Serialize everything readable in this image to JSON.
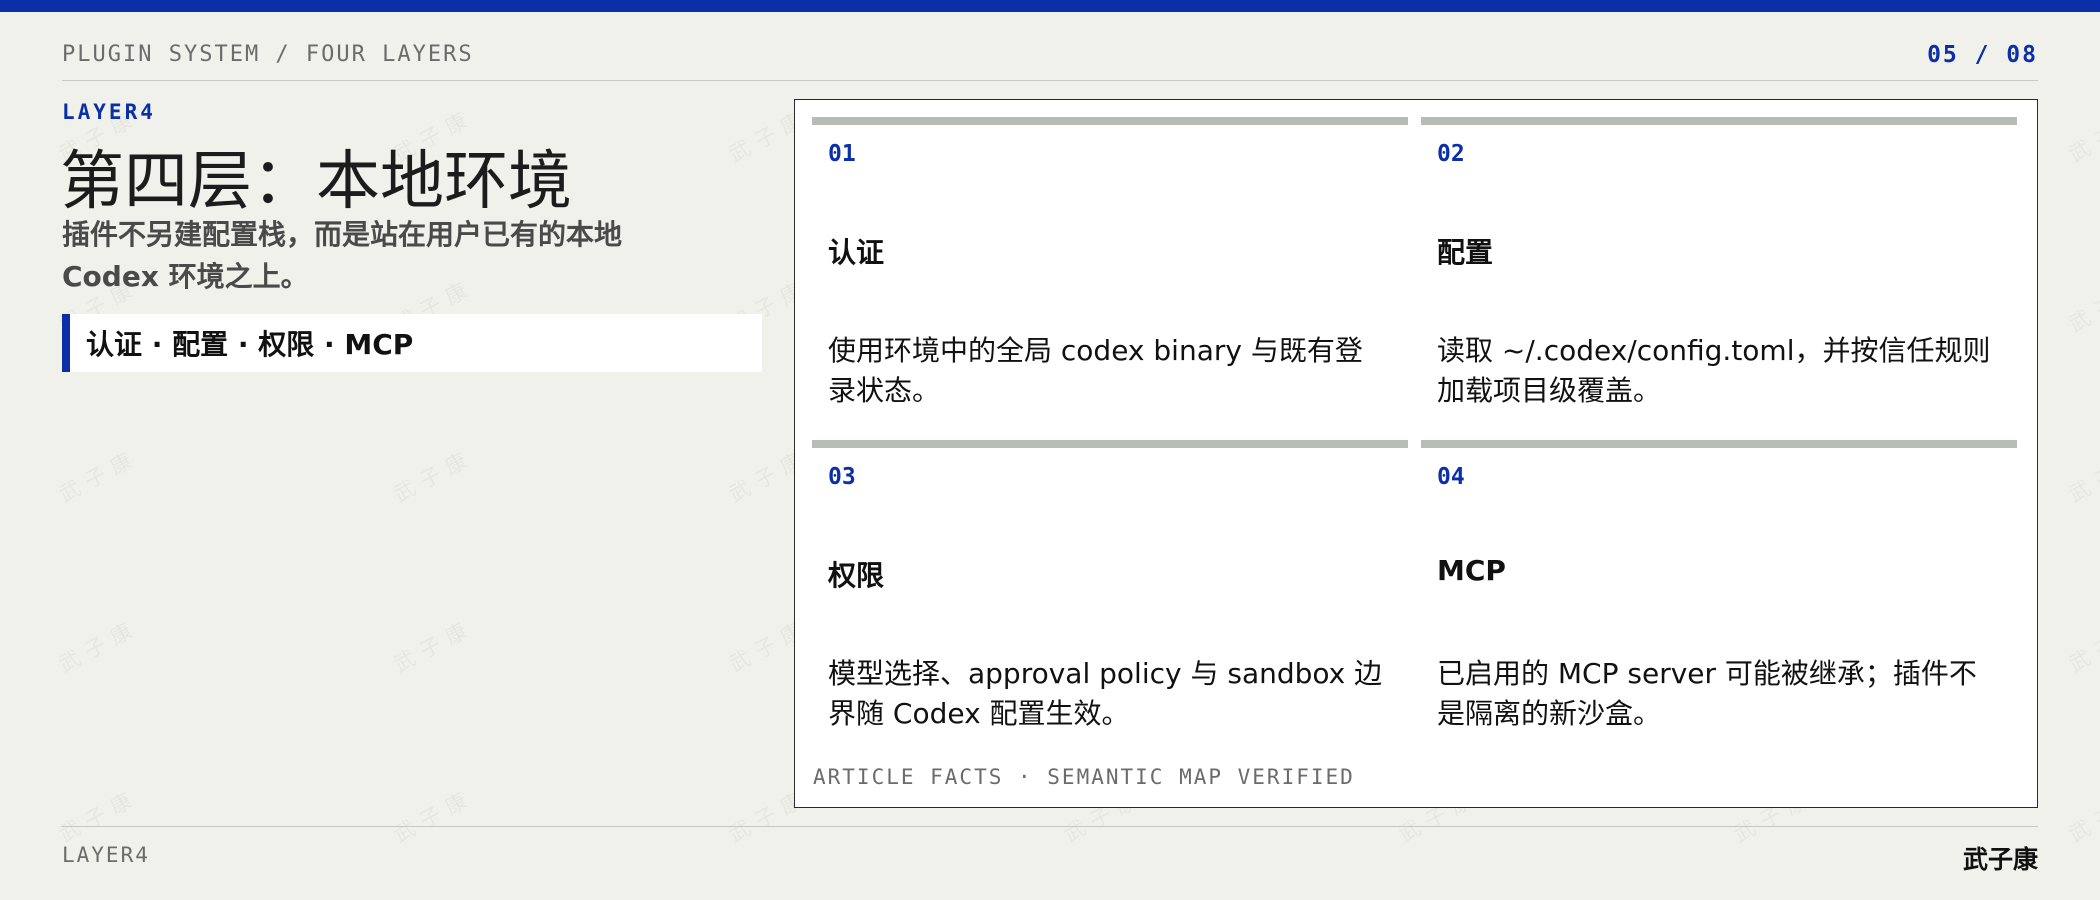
{
  "header": {
    "section": "PLUGIN SYSTEM / FOUR LAYERS",
    "page": "05 / 08"
  },
  "content": {
    "kicker": "LAYER4",
    "title": "第四层：本地环境",
    "subtitle": "插件不另建配置栈，而是站在用户已有的本地 Codex 环境之上。",
    "callout": "认证 · 配置 · 权限 · MCP"
  },
  "cards": [
    {
      "num": "01",
      "title": "认证",
      "desc": "使用环境中的全局 codex binary 与既有登录状态。"
    },
    {
      "num": "02",
      "title": "配置",
      "desc": "读取 ~/.codex/config.toml，并按信任规则加载项目级覆盖。"
    },
    {
      "num": "03",
      "title": "权限",
      "desc": "模型选择、approval policy 与 sandbox 边界随 Codex 配置生效。"
    },
    {
      "num": "04",
      "title": "MCP",
      "desc": "已启用的 MCP server 可能被继承；插件不是隔离的新沙盒。"
    }
  ],
  "panel_footer": "ARTICLE FACTS · SEMANTIC MAP VERIFIED",
  "footer": {
    "left": "LAYER4",
    "author": "武子康"
  },
  "watermark": "武子康",
  "colors": {
    "accent": "#0b2fa8",
    "background": "#f1f1ec",
    "card_rule": "#b7bdb6"
  }
}
